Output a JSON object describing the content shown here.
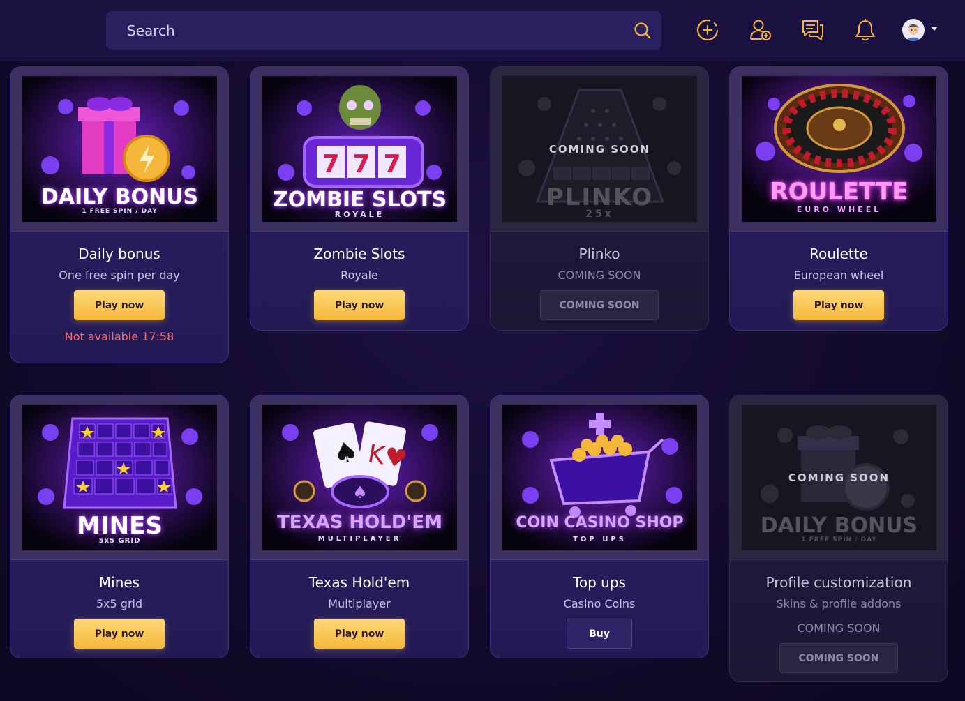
{
  "header": {
    "search_placeholder": "Search",
    "icons": [
      "search-icon",
      "add-coin-icon",
      "add-user-icon",
      "chat-icon",
      "bell-icon",
      "avatar",
      "caret-down-icon"
    ]
  },
  "colors": {
    "accent_gold": "#f4b73a",
    "card_bg": "#2c2168",
    "page_bg": "#130b2e",
    "error_red": "#ff6b6b"
  },
  "cards": [
    {
      "art_title": "DAILY BONUS",
      "art_sub": "1 FREE SPIN / DAY",
      "title": "Daily bonus",
      "subtitle": "One free spin per day",
      "button": "Play now",
      "note": "Not available 17:58"
    },
    {
      "art_title": "ZOMBIE SLOTS",
      "art_sub": "ROYALE",
      "title": "Zombie Slots",
      "subtitle": "Royale",
      "button": "Play now"
    },
    {
      "art_title": "PLINKO",
      "art_sub": "25x",
      "art_soon": "COMING SOON",
      "title": "Plinko",
      "subtitle": "COMING SOON",
      "button": "COMING SOON"
    },
    {
      "art_title": "ROULETTE",
      "art_sub": "EURO WHEEL",
      "title": "Roulette",
      "subtitle": "European wheel",
      "button": "Play now"
    },
    {
      "art_title": "MINES",
      "art_sub": "5x5 GRID",
      "title": "Mines",
      "subtitle": "5x5 grid",
      "button": "Play now"
    },
    {
      "art_title": "TEXAS HOLD'EM",
      "art_sub": "MULTIPLAYER",
      "title": "Texas Hold'em",
      "subtitle": "Multiplayer",
      "button": "Play now"
    },
    {
      "art_title": "COIN CASINO SHOP",
      "art_sub": "TOP UPS",
      "title": "Top ups",
      "subtitle": "Casino Coins",
      "button": "Buy"
    },
    {
      "art_title": "DAILY BONUS",
      "art_sub": "1 FREE SPIN / DAY",
      "art_soon": "COMING SOON",
      "title": "Profile customization",
      "subtitle": "Skins & profile addons",
      "note": "COMING SOON",
      "button": "COMING SOON"
    }
  ]
}
